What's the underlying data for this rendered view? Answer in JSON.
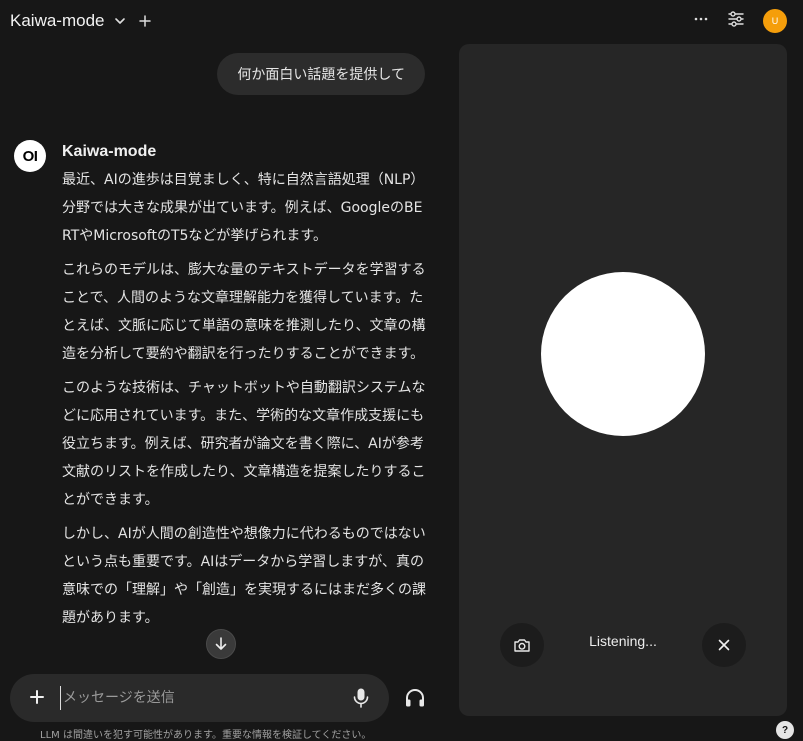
{
  "header": {
    "model_name": "Kaiwa-mode",
    "avatar_letter": "U"
  },
  "chat": {
    "user_message": "何か面白い話題を提供して",
    "assistant": {
      "avatar_text": "OI",
      "name": "Kaiwa-mode",
      "paragraphs": [
        "最近、AIの進歩は目覚ましく、特に自然言語処理（NLP）分野では大きな成果が出ています。例えば、GoogleのBERTやMicrosoftのT5などが挙げられます。",
        "これらのモデルは、膨大な量のテキストデータを学習することで、人間のような文章理解能力を獲得しています。たとえば、文脈に応じて単語の意味を推測したり、文章の構造を分析して要約や翻訳を行ったりすることができます。",
        "このような技術は、チャットボットや自動翻訳システムなどに応用されています。また、学術的な文章作成支援にも役立ちます。例えば、研究者が論文を書く際に、AIが参考文献のリストを作成したり、文章構造を提案したりすることができます。",
        "しかし、AIが人間の創造性や想像力に代わるものではないという点も重要です。AIはデータから学習しますが、真の意味での「理解」や「創造」を実現するにはまだ多くの課題があります。"
      ]
    }
  },
  "input": {
    "placeholder": "メッセージを送信",
    "value": ""
  },
  "disclaimer": "LLM は間違いを犯す可能性があります。重要な情報を検証してください。",
  "voice": {
    "status": "Listening..."
  },
  "help_label": "?",
  "colors": {
    "background": "#171717",
    "panel": "#262626",
    "avatar_accent": "#f59e0b"
  }
}
